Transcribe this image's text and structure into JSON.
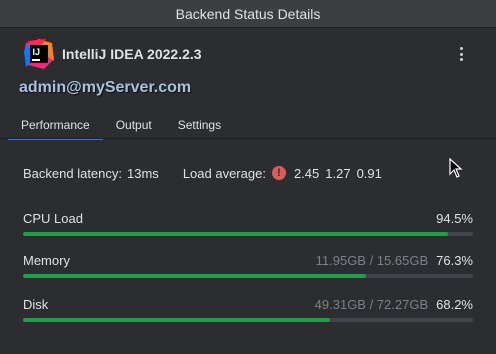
{
  "window": {
    "title": "Backend Status Details"
  },
  "product": {
    "logo_text": "IJ",
    "name": "IntelliJ IDEA 2022.2.3",
    "menu_icon": "more-vertical-icon"
  },
  "server": {
    "name": "admin@myServer.com"
  },
  "tabs": [
    {
      "label": "Performance",
      "active": true
    },
    {
      "label": "Output",
      "active": false
    },
    {
      "label": "Settings",
      "active": false
    }
  ],
  "stats": {
    "latency_label": "Backend latency:",
    "latency_value": "13ms",
    "load_label": "Load average:",
    "load_icon": "error-circle-icon",
    "load_icon_glyph": "!",
    "load_values": [
      "2.45",
      "1.27",
      "0.91"
    ]
  },
  "metrics": [
    {
      "label": "CPU Load",
      "detail": "",
      "percent_text": "94.5%",
      "fill": 0.945
    },
    {
      "label": "Memory",
      "detail": "11.95GB / 15.65GB",
      "percent_text": "76.3%",
      "fill": 0.763
    },
    {
      "label": "Disk",
      "detail": "49.31GB / 72.27GB",
      "percent_text": "68.2%",
      "fill": 0.682
    }
  ],
  "colors": {
    "accent_tab": "#3574f0",
    "bar_fill": "#1f9f4a",
    "error": "#db5c5c",
    "server_text": "#a9c0e0"
  }
}
